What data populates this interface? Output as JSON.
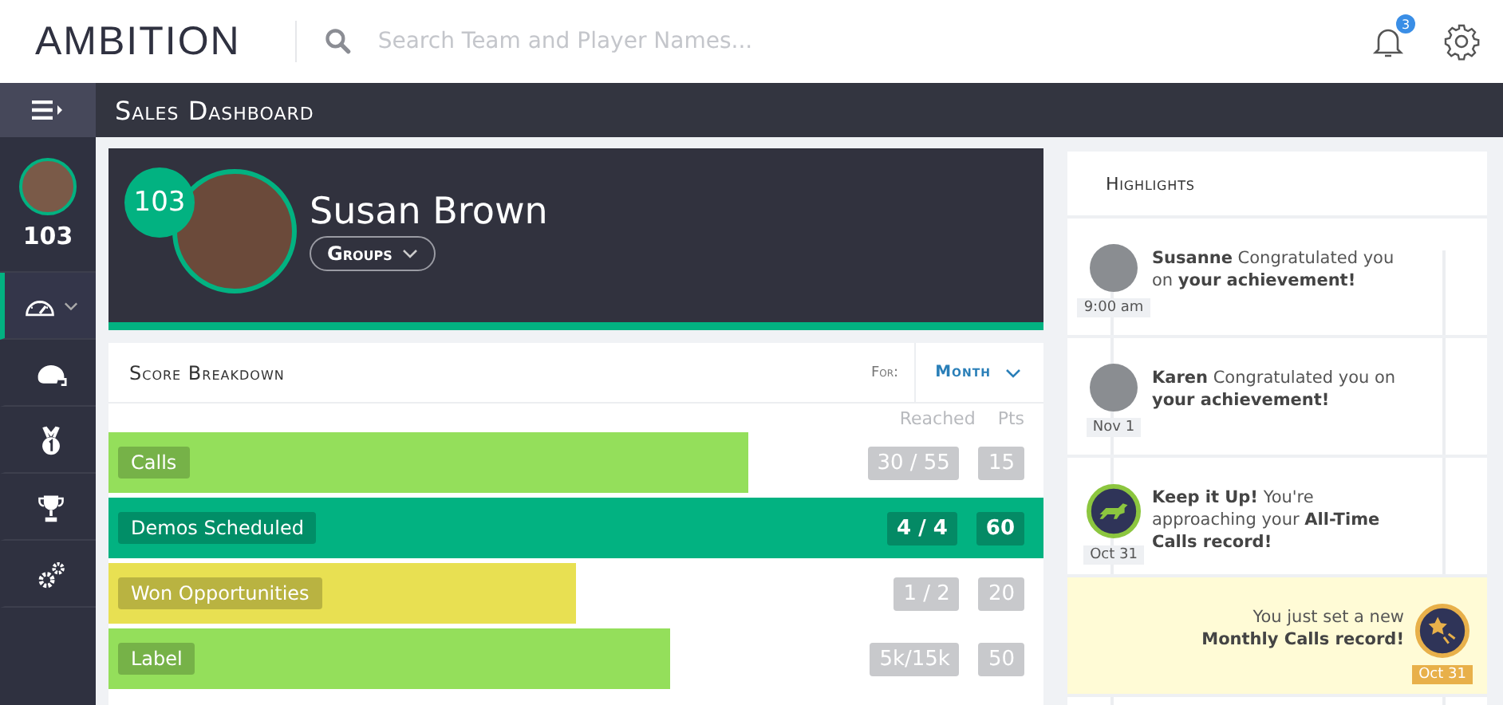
{
  "header": {
    "logo": "AMBITION",
    "search": {
      "placeholder": "Search Team and Player Names..."
    },
    "notifications": {
      "count": "3"
    }
  },
  "nav": {
    "title": "Sales Dashboard"
  },
  "sidebar": {
    "score": "103",
    "items": [
      {
        "kind": "gauge",
        "selected": true,
        "expandable": true
      },
      {
        "kind": "helmet",
        "selected": false,
        "expandable": false
      },
      {
        "kind": "medal",
        "selected": false,
        "expandable": false
      },
      {
        "kind": "trophy",
        "selected": false,
        "expandable": false
      },
      {
        "kind": "gears",
        "selected": false,
        "expandable": false
      }
    ]
  },
  "profile": {
    "score": "103",
    "name": "Susan Brown",
    "groups_button": "Groups"
  },
  "score_breakdown": {
    "title": "Score Breakdown",
    "for_label": "For:",
    "period": "Month",
    "columns": [
      "Reached",
      "Pts"
    ],
    "rows": [
      {
        "label": "Calls",
        "reached": "30 / 55",
        "points": "15",
        "level": 0.685,
        "color": "#94df5b",
        "complete": false
      },
      {
        "label": "Demos Scheduled",
        "reached": "4 / 4",
        "points": "60",
        "level": 1,
        "color": "#02b281",
        "complete": true
      },
      {
        "label": "Won Opportunities",
        "reached": "1 / 2",
        "points": "20",
        "level": 0.5,
        "color": "#e8e052",
        "complete": false
      },
      {
        "label": "Label",
        "reached": "5k/15k",
        "points": "50",
        "level": 0.6,
        "color": "#94df5b",
        "complete": false
      }
    ]
  },
  "highlights": {
    "title": "Highlights",
    "items": [
      {
        "kind": "person",
        "text": "**Susanne** Congratulated you on **your achievement!**",
        "time": "9:00 am"
      },
      {
        "kind": "person",
        "text": "**Karen** Congratulated you on **your achievement!**",
        "time": "Nov 1"
      },
      {
        "kind": "badge",
        "text": "**Keep it Up!** You're approaching your **All-Time Calls record!**",
        "time": "Oct 31"
      },
      {
        "kind": "record",
        "text": "You just set a new **Monthly Calls record!**",
        "time": "Oct 31"
      }
    ]
  }
}
